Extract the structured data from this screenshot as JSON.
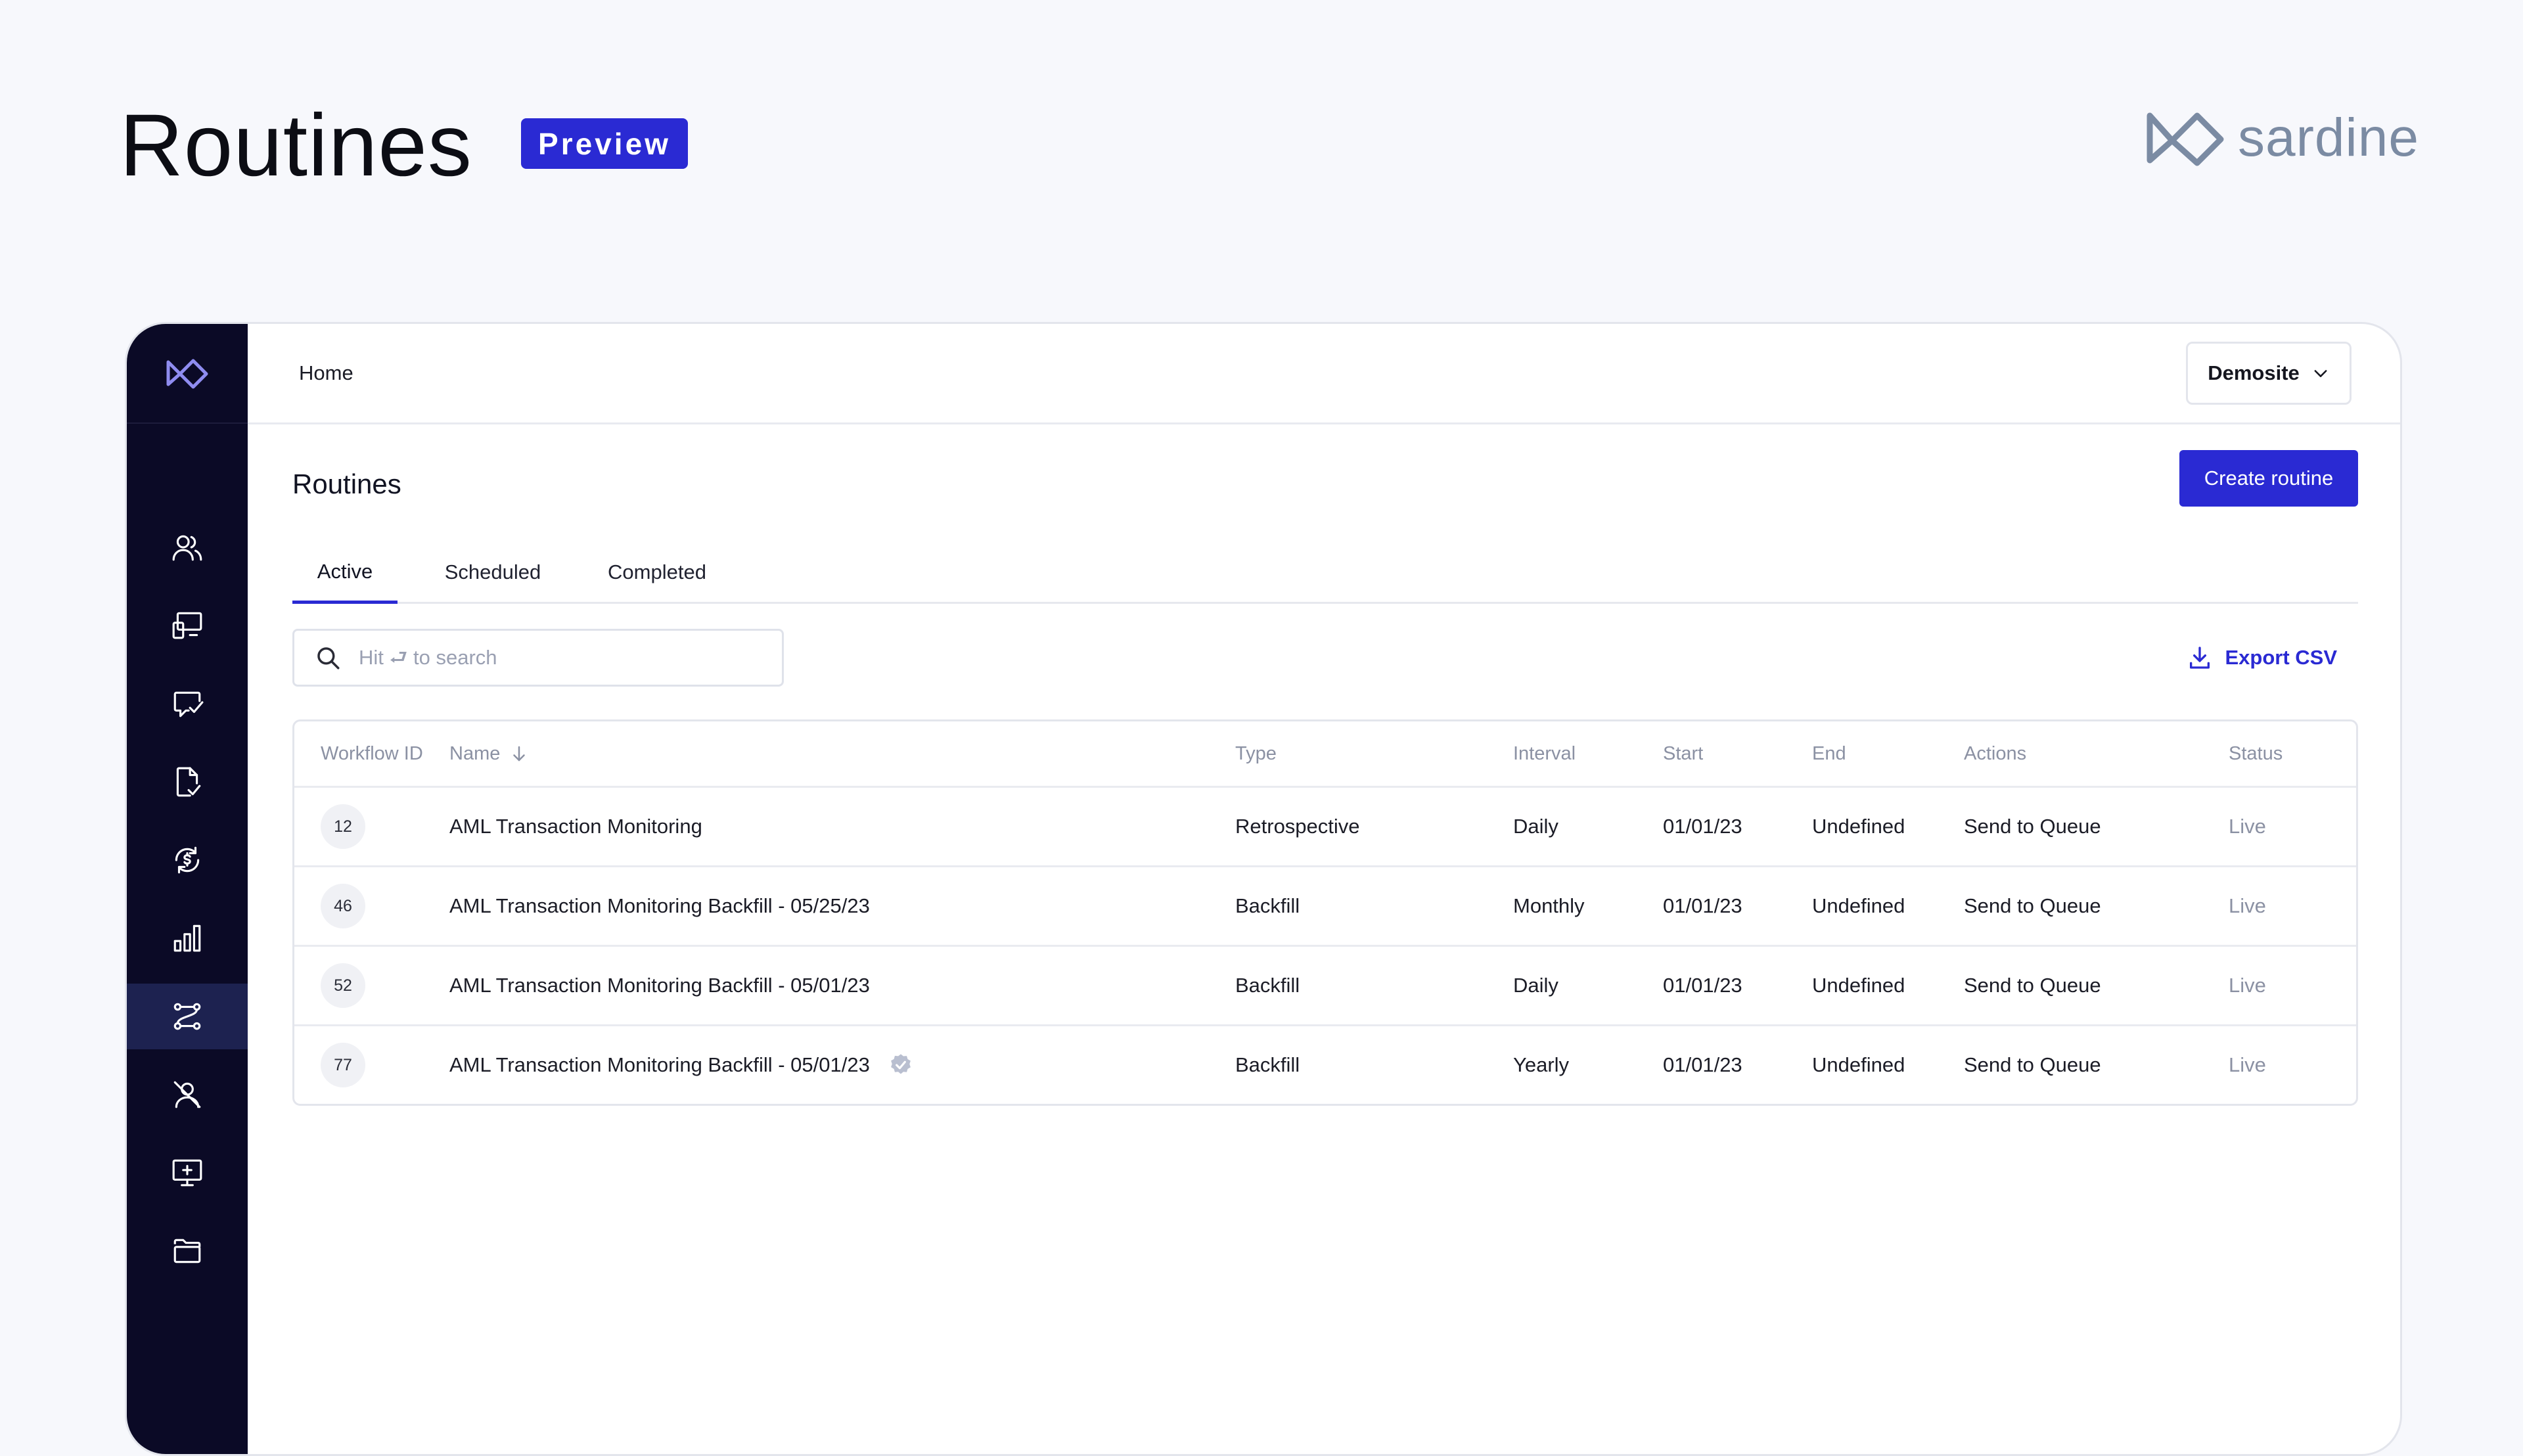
{
  "page": {
    "title": "Routines",
    "badge": "Preview",
    "brand": "sardine"
  },
  "topbar": {
    "breadcrumb": "Home",
    "site": "Demosite"
  },
  "sidebar": {
    "active_index": 6,
    "items": [
      {
        "icon": "users-icon"
      },
      {
        "icon": "monitor-dashboard-icon"
      },
      {
        "icon": "chat-check-icon"
      },
      {
        "icon": "document-check-icon"
      },
      {
        "icon": "refresh-dollar-icon"
      },
      {
        "icon": "bar-chart-icon"
      },
      {
        "icon": "workflow-routes-icon"
      },
      {
        "icon": "user-blocked-icon"
      },
      {
        "icon": "monitor-plus-icon"
      },
      {
        "icon": "folder-icon"
      }
    ]
  },
  "main": {
    "title": "Routines",
    "create_label": "Create routine",
    "tabs": [
      {
        "label": "Active",
        "active": true
      },
      {
        "label": "Scheduled",
        "active": false
      },
      {
        "label": "Completed",
        "active": false
      }
    ],
    "search_placeholder": "Hit ⮐ to search",
    "export_label": "Export CSV"
  },
  "table": {
    "columns": [
      "Workflow ID",
      "Name",
      "Type",
      "Interval",
      "Start",
      "End",
      "Actions",
      "Status"
    ],
    "rows": [
      {
        "id": "12",
        "name": "AML Transaction Monitoring",
        "type": "Retrospective",
        "interval": "Daily",
        "start": "01/01/23",
        "end": "Undefined",
        "action": "Send to Queue",
        "status": "Live",
        "verified": false
      },
      {
        "id": "46",
        "name": "AML Transaction Monitoring Backfill - 05/25/23",
        "type": "Backfill",
        "interval": "Monthly",
        "start": "01/01/23",
        "end": "Undefined",
        "action": "Send to Queue",
        "status": "Live",
        "verified": false
      },
      {
        "id": "52",
        "name": "AML Transaction Monitoring Backfill - 05/01/23",
        "type": "Backfill",
        "interval": "Daily",
        "start": "01/01/23",
        "end": "Undefined",
        "action": "Send to Queue",
        "status": "Live",
        "verified": false
      },
      {
        "id": "77",
        "name": "AML Transaction Monitoring Backfill - 05/01/23",
        "type": "Backfill",
        "interval": "Yearly",
        "start": "01/01/23",
        "end": "Undefined",
        "action": "Send to Queue",
        "status": "Live",
        "verified": true
      }
    ]
  },
  "colors": {
    "accent": "#2a2ad3",
    "sidebar": "#0b0a26",
    "brand_gray": "#7b8ba3"
  }
}
